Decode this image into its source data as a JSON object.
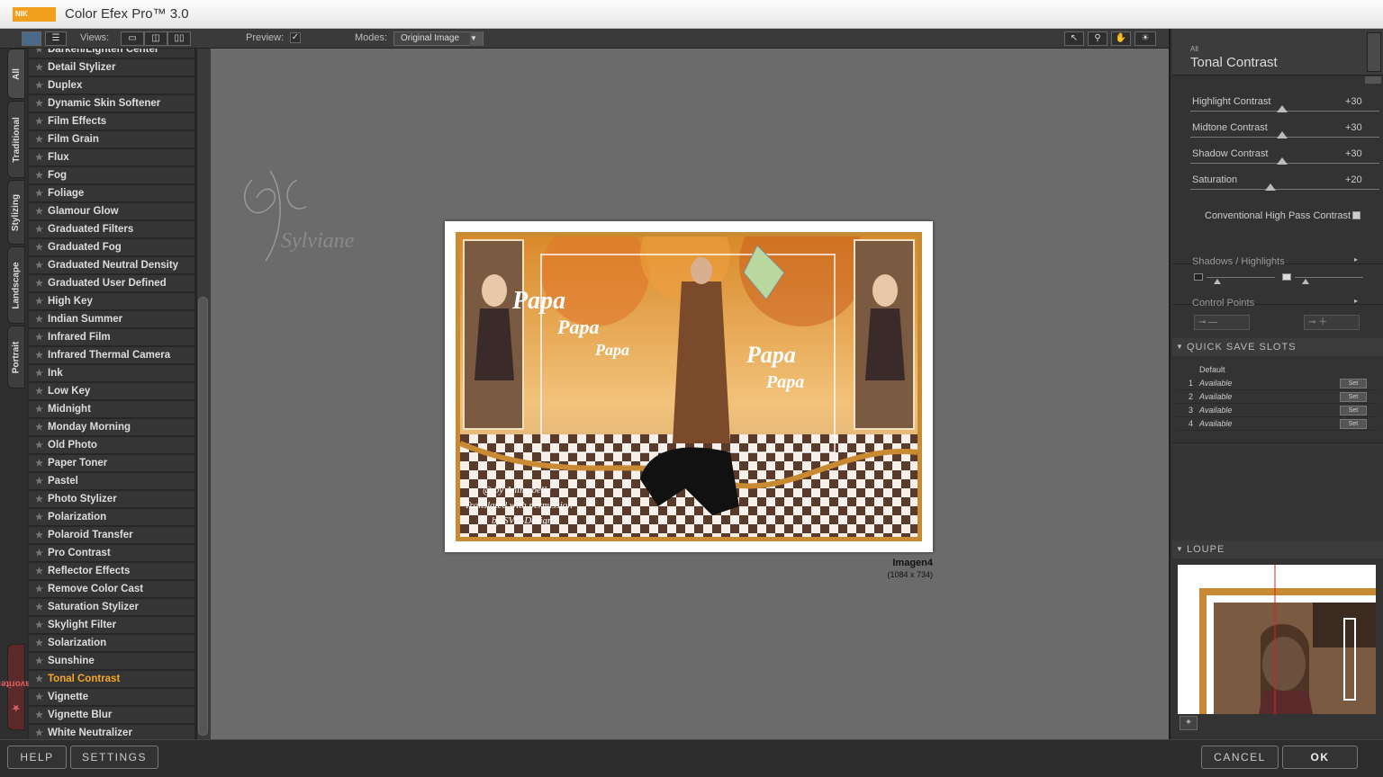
{
  "titlebar": {
    "logo_text": "NIK",
    "title": "Color Efex Pro™ 3.0"
  },
  "toolbar": {
    "views_label": "Views:",
    "preview_label": "Preview:",
    "preview_checked": true,
    "modes_label": "Modes:",
    "modes_value": "Original Image"
  },
  "side_tabs": [
    "All",
    "Traditional",
    "Stylizing",
    "Landscape",
    "Portrait",
    "Favorites"
  ],
  "filters": [
    "Darken/Lighten Center",
    "Detail Stylizer",
    "Duplex",
    "Dynamic Skin Softener",
    "Film Effects",
    "Film Grain",
    "Flux",
    "Fog",
    "Foliage",
    "Glamour Glow",
    "Graduated Filters",
    "Graduated Fog",
    "Graduated Neutral Density",
    "Graduated User Defined",
    "High Key",
    "Indian Summer",
    "Infrared Film",
    "Infrared Thermal Camera",
    "Ink",
    "Low Key",
    "Midnight",
    "Monday Morning",
    "Old Photo",
    "Paper Toner",
    "Pastel",
    "Photo Stylizer",
    "Polarization",
    "Polaroid Transfer",
    "Pro Contrast",
    "Reflector Effects",
    "Remove Color Cast",
    "Saturation Stylizer",
    "Skylight Filter",
    "Solarization",
    "Sunshine",
    "Tonal Contrast",
    "Vignette",
    "Vignette Blur",
    "White Neutralizer"
  ],
  "active_filter": "Tonal Contrast",
  "image": {
    "name": "Imagen4",
    "size": "(1084 x 734)",
    "watermark": "Sylviane",
    "overlay_words": [
      "Papa",
      "Papa",
      "Papa",
      "Papa",
      "Papa"
    ],
    "credit_lines": [
      "@ by Animabelle",
      "Translated with permission",
      "by SVC-Design"
    ]
  },
  "panel": {
    "category": "All",
    "filter_name": "Tonal Contrast",
    "sliders": [
      {
        "label": "Highlight Contrast",
        "value": "+30",
        "level": 0.3
      },
      {
        "label": "Midtone Contrast",
        "value": "+30",
        "level": 0.3
      },
      {
        "label": "Shadow Contrast",
        "value": "+30",
        "level": 0.3
      },
      {
        "label": "Saturation",
        "value": "+20",
        "level": 0.2
      }
    ],
    "checkbox_label": "Conventional High Pass Contrast",
    "checkbox_checked": false,
    "shadows_highlights": "Shadows / Highlights",
    "control_points": "Control Points",
    "quick_save": "QUICK SAVE SLOTS",
    "default_label": "Default",
    "slots": [
      {
        "num": "1",
        "status": "Available"
      },
      {
        "num": "2",
        "status": "Available"
      },
      {
        "num": "3",
        "status": "Available"
      },
      {
        "num": "4",
        "status": "Available"
      }
    ],
    "set_label": "Set",
    "loupe": "LOUPE"
  },
  "buttons": {
    "help": "HELP",
    "settings": "SETTINGS",
    "cancel": "CANCEL",
    "ok": "OK"
  }
}
